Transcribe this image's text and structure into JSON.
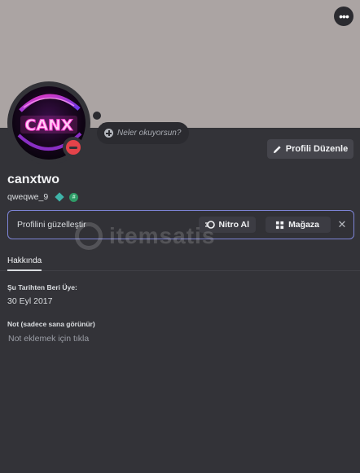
{
  "profile": {
    "display_name": "canxtwo",
    "username": "qweqwe_9",
    "avatar_text": "CANX",
    "status": "do-not-disturb",
    "custom_status_placeholder": "Neler okuyorsun?"
  },
  "actions": {
    "more_icon": "ellipsis-icon",
    "edit_profile_label": "Profili Düzenle",
    "edit_icon": "pencil-icon"
  },
  "upsell": {
    "text": "Profilini güzelleştir",
    "nitro_label": "Nitro Al",
    "shop_label": "Mağaza",
    "close_icon": "close-icon"
  },
  "watermark": {
    "text": "itemsatis"
  },
  "tabs": [
    {
      "label": "Hakkında",
      "active": true
    }
  ],
  "about": {
    "member_since_label": "Şu Tarihten Beri Üye:",
    "member_since_value": "30 Eyl 2017",
    "note_label": "Not (sadece sana görünür)",
    "note_placeholder": "Not eklemek için tıkla"
  },
  "colors": {
    "banner": "#aba4a3",
    "background": "#333338",
    "dnd": "#e4434a",
    "upsell_border": "#7d84d6",
    "avatar_neon": "#ff4fd8"
  }
}
